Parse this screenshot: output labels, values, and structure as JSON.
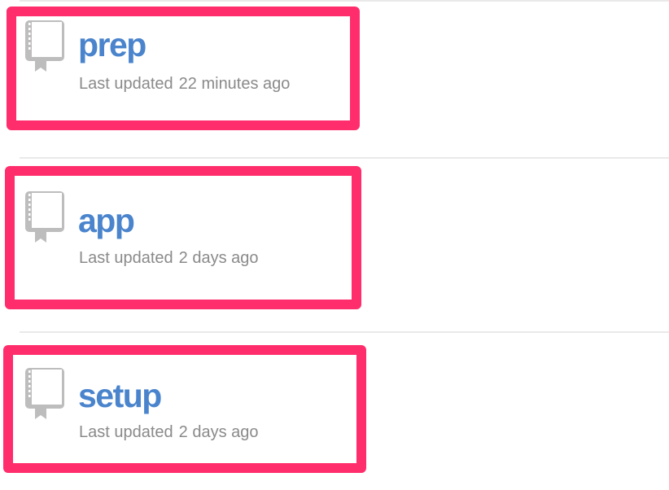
{
  "repositories": [
    {
      "name": "prep",
      "updated_label": "Last updated",
      "updated_value": "22 minutes ago"
    },
    {
      "name": "app",
      "updated_label": "Last updated",
      "updated_value": "2 days ago"
    },
    {
      "name": "setup",
      "updated_label": "Last updated",
      "updated_value": "2 days ago"
    }
  ],
  "icons": {
    "repo": "book-icon"
  },
  "colors": {
    "highlight": "#ff2d6b",
    "link": "#4a84cc",
    "meta_text": "#8a8a8a",
    "icon": "#bdbdbd",
    "divider": "#e9e9e9"
  }
}
